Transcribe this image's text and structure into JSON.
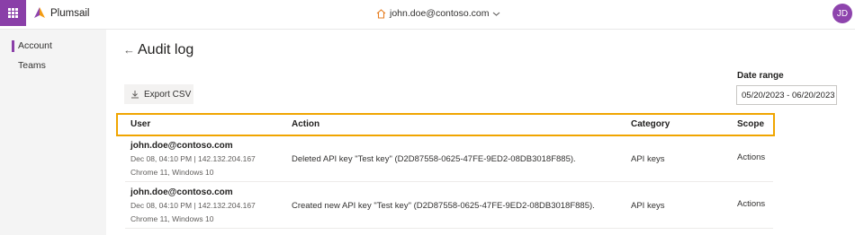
{
  "brand": {
    "name": "Plumsail"
  },
  "header": {
    "account": "john.doe@contoso.com",
    "avatar_initials": "JD"
  },
  "sidebar": {
    "items": [
      {
        "label": "Account"
      },
      {
        "label": "Teams"
      }
    ]
  },
  "page": {
    "title": "Audit log",
    "export_label": "Export CSV",
    "date_range_label": "Date range",
    "date_range_value": "05/20/2023 - 06/20/2023"
  },
  "table": {
    "columns": [
      "User",
      "Action",
      "Category",
      "Scope"
    ],
    "rows": [
      {
        "user": "john.doe@contoso.com",
        "time_ip": "Dec 08, 04:10 PM | 142.132.204.167",
        "browser": "Chrome 11, Windows 10",
        "action": "Deleted API key \"Test key\" (D2D87558-0625-47FE-9ED2-08DB3018F885).",
        "category": "API keys",
        "scope": "Actions"
      },
      {
        "user": "john.doe@contoso.com",
        "time_ip": "Dec 08, 04:10 PM | 142.132.204.167",
        "browser": "Chrome 11, Windows 10",
        "action": "Created new API key \"Test key\" (D2D87558-0625-47FE-9ED2-08DB3018F885).",
        "category": "API keys",
        "scope": "Actions"
      }
    ]
  },
  "colors": {
    "accent": "#8a3fa8",
    "highlight": "#f0a500"
  }
}
